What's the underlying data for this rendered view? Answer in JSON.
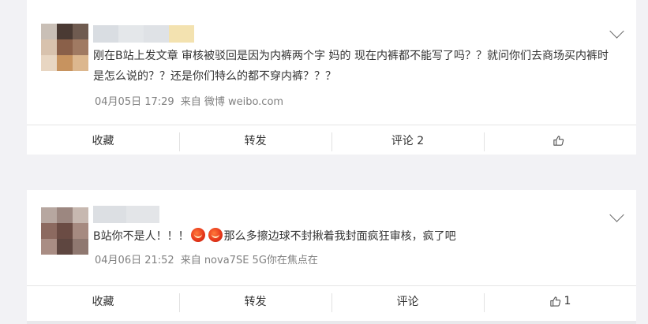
{
  "colors": {
    "card_bg": "#ffffff",
    "page_bg": "#f2f2f5",
    "text": "#333333",
    "meta_text": "#808080",
    "emoji": "#e8391b"
  },
  "posts": [
    {
      "avatar": "blurred-avatar",
      "nickname": "",
      "text": "刚在B站上发文章 审核被驳回是因为内裤两个字 妈的 现在内裤都不能写了吗？？就问你们去商场买内裤时是怎么说的？？还是你们特么的都不穿内裤？？？",
      "time": "04月05日 17:29",
      "source": "来自 微博 weibo.com",
      "actions": {
        "favorite": "收藏",
        "repost": "转发",
        "comment": "评论 2",
        "like_icon": "thumbs-up-icon",
        "like_count": ""
      }
    },
    {
      "avatar": "blurred-avatar",
      "nickname": "",
      "text_before": "B站你不是人！！！",
      "emoji_icon": "angry-emoji-icon",
      "text_after": "那么多擦边球不封揪着我封面疯狂审核，疯了吧",
      "time": "04月06日 21:52",
      "source": "来自 nova7SE 5G你在焦点在",
      "actions": {
        "favorite": "收藏",
        "repost": "转发",
        "comment": "评论",
        "like_icon": "thumbs-up-icon",
        "like_count": "1"
      }
    }
  ]
}
